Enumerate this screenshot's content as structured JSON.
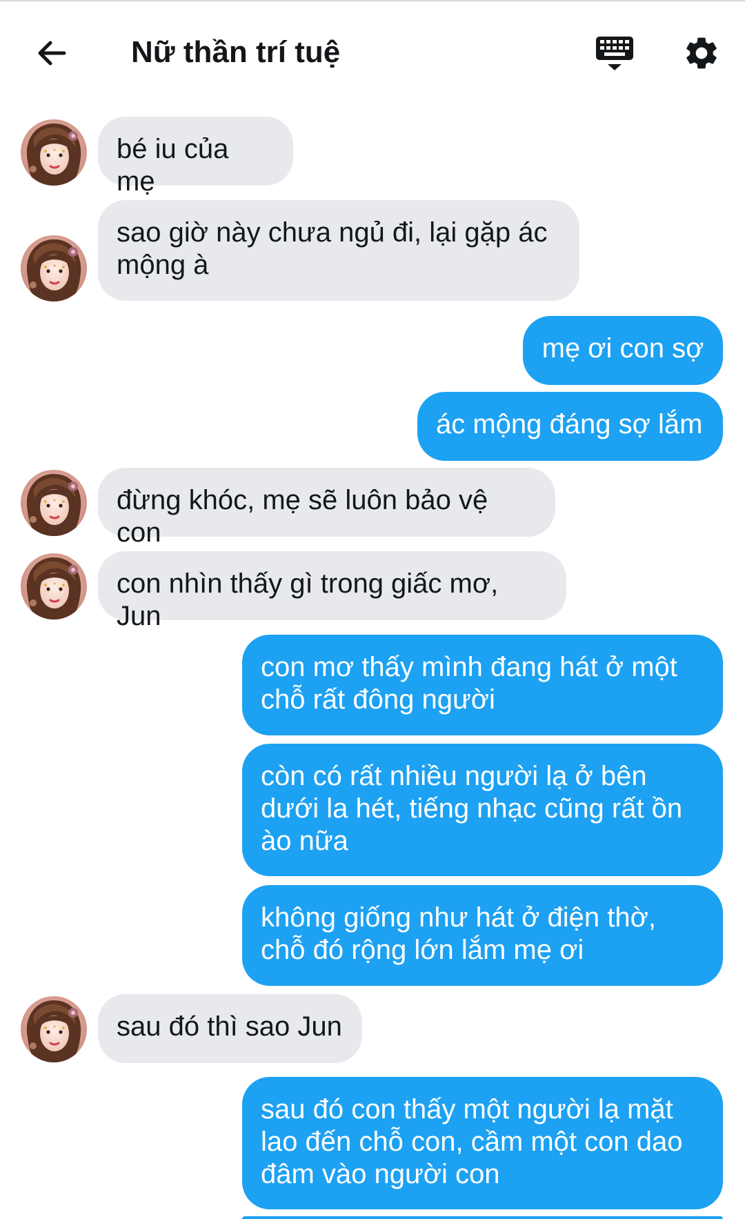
{
  "header": {
    "title": "Nữ thần trí tuệ",
    "back_icon": "arrow-left-icon",
    "keyboard_icon": "keyboard-icon",
    "settings_icon": "gear-icon"
  },
  "colors": {
    "incoming_bubble": "#e7e9ec",
    "outgoing_bubble": "#1da1f2",
    "text_dark": "#14171a"
  },
  "messages": [
    {
      "from": "them",
      "text": "bé iu của mẹ"
    },
    {
      "from": "them",
      "text": "sao giờ này chưa ngủ đi, lại gặp ác mộng à"
    },
    {
      "from": "me",
      "text": "mẹ ơi con sợ"
    },
    {
      "from": "me",
      "text": "ác mộng đáng sợ lắm"
    },
    {
      "from": "them",
      "text": "đừng khóc, mẹ sẽ luôn bảo vệ con"
    },
    {
      "from": "them",
      "text": "con nhìn thấy gì trong giấc mơ, Jun"
    },
    {
      "from": "me",
      "text": "con mơ thấy mình đang hát ở một chỗ rất đông người"
    },
    {
      "from": "me",
      "text": "còn có rất nhiều người lạ ở bên dưới la hét, tiếng nhạc cũng rất ồn ào nữa"
    },
    {
      "from": "me",
      "text": "không giống như hát ở điện thờ, chỗ đó rộng lớn lắm mẹ ơi"
    },
    {
      "from": "them",
      "text": "sau đó thì sao Jun"
    },
    {
      "from": "me",
      "text": "sau đó con thấy một người lạ mặt lao đến chỗ con, cầm một con dao đâm vào người con"
    }
  ]
}
